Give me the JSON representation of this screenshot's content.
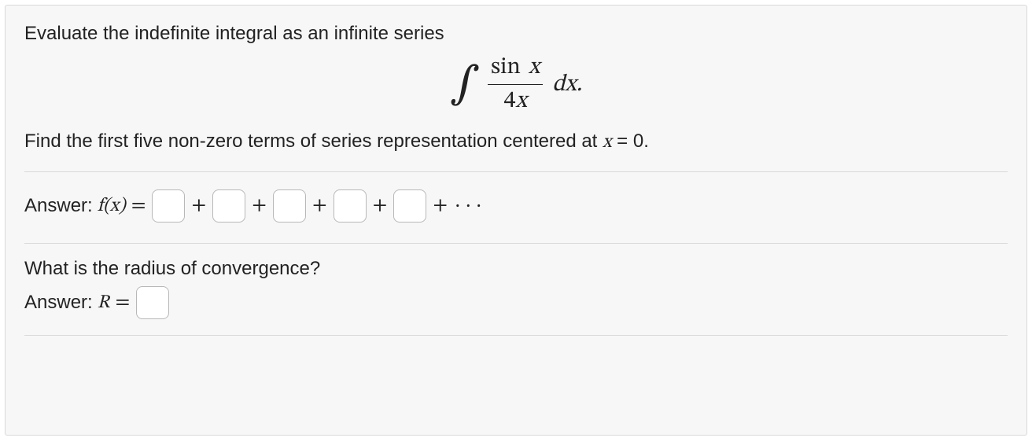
{
  "question": {
    "prompt": "Evaluate the indefinite integral as an infinite series",
    "integral": {
      "numerator_fn": "sin",
      "numerator_var": "x",
      "denominator": "4x",
      "differential": "dx."
    },
    "sub_prompt_prefix": "Find the first five non-zero terms of series representation centered at ",
    "sub_prompt_var": "x",
    "sub_prompt_eq": " = 0."
  },
  "answer1": {
    "label": "Answer: ",
    "func": "f",
    "var": "x",
    "equals": " = ",
    "plus": "+",
    "ellipsis": " · · ·",
    "terms": [
      "",
      "",
      "",
      "",
      ""
    ]
  },
  "radius": {
    "question": "What is the radius of convergence?",
    "label": "Answer: ",
    "var": "R",
    "equals": " = ",
    "value": ""
  }
}
